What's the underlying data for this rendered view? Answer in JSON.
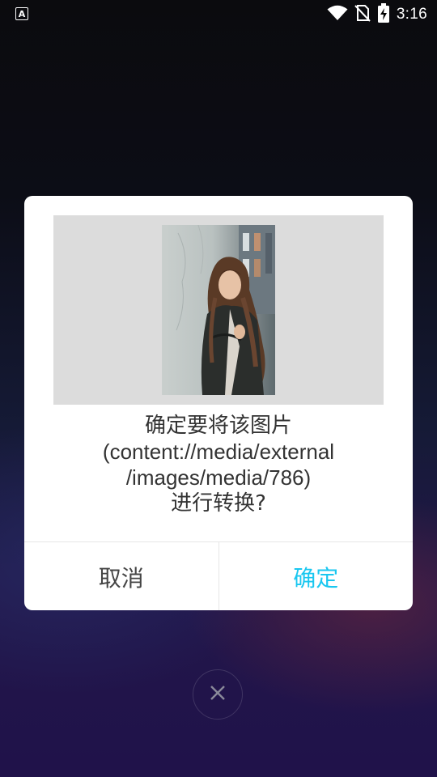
{
  "status_bar": {
    "app_icon_label": "A",
    "time": "3:16",
    "icons": [
      "wifi-icon",
      "no-sim-icon",
      "battery-charging-icon"
    ]
  },
  "dialog": {
    "preview_image": "portrait-photo-woman",
    "message_lines": [
      "确定要将该图片",
      "(content://media/external",
      "/images/media/786)",
      "进行转换?"
    ],
    "cancel_label": "取消",
    "confirm_label": "确定",
    "confirm_color": "#19c7f0"
  },
  "close_icon": "close-icon"
}
